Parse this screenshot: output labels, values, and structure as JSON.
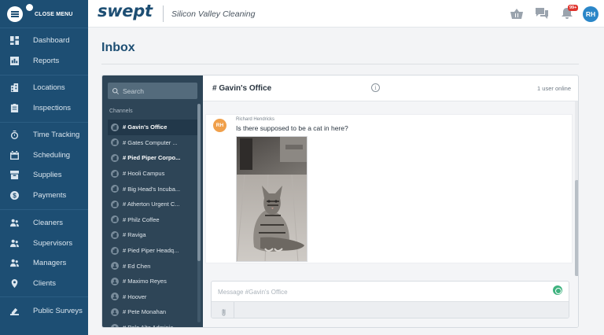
{
  "sidebar": {
    "close_label": "CLOSE MENU",
    "groups": [
      [
        {
          "label": "Dashboard",
          "icon": "dashboard-icon"
        },
        {
          "label": "Reports",
          "icon": "reports-icon"
        }
      ],
      [
        {
          "label": "Locations",
          "icon": "building-icon"
        },
        {
          "label": "Inspections",
          "icon": "clipboard-icon"
        }
      ],
      [
        {
          "label": "Time Tracking",
          "icon": "stopwatch-icon"
        },
        {
          "label": "Scheduling",
          "icon": "calendar-icon"
        },
        {
          "label": "Supplies",
          "icon": "box-icon"
        },
        {
          "label": "Payments",
          "icon": "dollar-icon"
        }
      ],
      [
        {
          "label": "Cleaners",
          "icon": "people-icon"
        },
        {
          "label": "Supervisors",
          "icon": "people-icon"
        },
        {
          "label": "Managers",
          "icon": "people-icon"
        },
        {
          "label": "Clients",
          "icon": "pin-icon"
        }
      ],
      [
        {
          "label": "Public Surveys",
          "icon": "survey-icon"
        }
      ]
    ]
  },
  "topbar": {
    "brand": "swept",
    "company": "Silicon Valley Cleaning",
    "badge": "99+",
    "avatar": "RH"
  },
  "page": {
    "title": "Inbox"
  },
  "channels": {
    "search_placeholder": "Search",
    "heading": "Channels",
    "items": [
      {
        "label": "# Gavin's Office",
        "type": "channel",
        "state": "active"
      },
      {
        "label": "# Gates Computer ...",
        "type": "channel",
        "state": ""
      },
      {
        "label": "# Pied Piper Corpo...",
        "type": "channel",
        "state": "bold"
      },
      {
        "label": "# Hooli Campus",
        "type": "channel",
        "state": ""
      },
      {
        "label": "# Big Head's Incuba...",
        "type": "channel",
        "state": ""
      },
      {
        "label": "# Atherton Urgent C...",
        "type": "channel",
        "state": ""
      },
      {
        "label": "# Philz Coffee",
        "type": "channel",
        "state": ""
      },
      {
        "label": "# Raviga",
        "type": "channel",
        "state": ""
      },
      {
        "label": "# Pied Piper Headq...",
        "type": "channel",
        "state": ""
      },
      {
        "label": "# Ed Chen",
        "type": "person",
        "state": ""
      },
      {
        "label": "# Maximo Reyes",
        "type": "person",
        "state": ""
      },
      {
        "label": "# Hoover",
        "type": "person",
        "state": ""
      },
      {
        "label": "# Pete Monahan",
        "type": "person",
        "state": ""
      },
      {
        "label": "# Palo Alto Adminis...",
        "type": "person",
        "state": ""
      }
    ]
  },
  "chat": {
    "title": "# Gavin's Office",
    "online": "1 user online",
    "message": {
      "avatar": "RH",
      "author": "Richard Hendricks",
      "text": "Is there supposed to be a cat in here?"
    },
    "composer_placeholder": "Message #Gavin's Office"
  },
  "colors": {
    "sidebar": "#1d4e73",
    "channel_sidebar": "#2e4557",
    "accent": "#2a86c8",
    "badge": "#e0352f",
    "message_avatar": "#f0a04b"
  }
}
